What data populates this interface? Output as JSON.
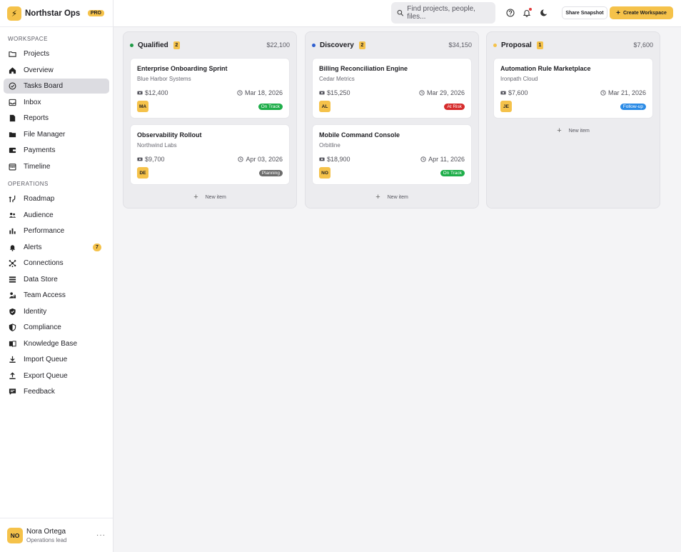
{
  "brand": {
    "name": "Northstar Ops",
    "badge": "PRO",
    "logo_icon": "bolt-icon"
  },
  "sidebar": {
    "workspace_label": "WORKSPACE",
    "operations_label": "OPERATIONS",
    "workspace_items": [
      {
        "label": "Projects",
        "icon": "folder-icon"
      },
      {
        "label": "Overview",
        "icon": "home-icon"
      },
      {
        "label": "Tasks Board",
        "icon": "check-circle-icon",
        "active": true
      },
      {
        "label": "Inbox",
        "icon": "inbox-icon"
      },
      {
        "label": "Reports",
        "icon": "document-icon"
      },
      {
        "label": "File Manager",
        "icon": "folder-filled-icon"
      },
      {
        "label": "Payments",
        "icon": "wallet-icon"
      },
      {
        "label": "Timeline",
        "icon": "calendar-icon"
      }
    ],
    "operations_items": [
      {
        "label": "Roadmap",
        "icon": "route-icon"
      },
      {
        "label": "Audience",
        "icon": "people-icon"
      },
      {
        "label": "Performance",
        "icon": "bar-chart-icon"
      },
      {
        "label": "Alerts",
        "icon": "bell-icon",
        "count": "7"
      },
      {
        "label": "Connections",
        "icon": "network-icon"
      },
      {
        "label": "Data Store",
        "icon": "list-icon"
      },
      {
        "label": "Team Access",
        "icon": "user-lock-icon"
      },
      {
        "label": "Identity",
        "icon": "shield-check-icon"
      },
      {
        "label": "Compliance",
        "icon": "shield-half-icon"
      },
      {
        "label": "Knowledge Base",
        "icon": "book-icon"
      },
      {
        "label": "Import Queue",
        "icon": "download-icon"
      },
      {
        "label": "Export Queue",
        "icon": "upload-icon"
      },
      {
        "label": "Feedback",
        "icon": "chat-icon"
      }
    ]
  },
  "user": {
    "initials": "NO",
    "name": "Nora Ortega",
    "role": "Operations lead",
    "more": "···"
  },
  "header": {
    "search_placeholder": "Find projects, people, files...",
    "share_label": "Share Snapshot",
    "create_label": "Create Workspace",
    "create_plus": "+"
  },
  "colors": {
    "accent": "#f5c24a",
    "on_track": "#1fae4a",
    "at_risk": "#d62b2b",
    "planning": "#6c6c6c",
    "follow_up": "#2b8be6"
  },
  "columns": [
    {
      "title": "Qualified",
      "count": "2",
      "total": "$22,100",
      "dot_color": "#1e9a46",
      "cards": [
        {
          "title": "Enterprise Onboarding Sprint",
          "client": "Blue Harbor Systems",
          "amount": "$12,400",
          "date": "Mar 18, 2026",
          "initials": "MA",
          "status": "On Track",
          "status_color": "#1fae4a"
        },
        {
          "title": "Observability Rollout",
          "client": "Northwind Labs",
          "amount": "$9,700",
          "date": "Apr 03, 2026",
          "initials": "DE",
          "status": "Planning",
          "status_color": "#6c6c6c"
        }
      ],
      "new_item": "New item"
    },
    {
      "title": "Discovery",
      "count": "2",
      "total": "$34,150",
      "dot_color": "#2f5fd0",
      "cards": [
        {
          "title": "Billing Reconciliation Engine",
          "client": "Cedar Metrics",
          "amount": "$15,250",
          "date": "Mar 29, 2026",
          "initials": "AL",
          "status": "At Risk",
          "status_color": "#d62b2b"
        },
        {
          "title": "Mobile Command Console",
          "client": "Orbitline",
          "amount": "$18,900",
          "date": "Apr 11, 2026",
          "initials": "NO",
          "status": "On Track",
          "status_color": "#1fae4a"
        }
      ],
      "new_item": "New item"
    },
    {
      "title": "Proposal",
      "count": "1",
      "total": "$7,600",
      "dot_color": "#f5c24a",
      "cards": [
        {
          "title": "Automation Rule Marketplace",
          "client": "Ironpath Cloud",
          "amount": "$7,600",
          "date": "Mar 21, 2026",
          "initials": "JE",
          "status": "Follow-up",
          "status_color": "#2b8be6"
        }
      ],
      "new_item": "New item"
    }
  ]
}
